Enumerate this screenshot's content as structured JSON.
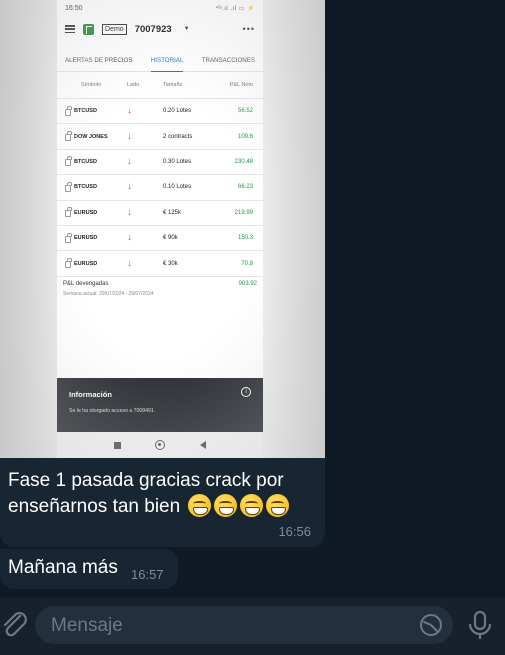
{
  "phone": {
    "status_time": "16:50",
    "status_right": "⁴ᴳ.ıl .ıl ▭ ⚡",
    "account_label": "Demo",
    "account_number": "7007923",
    "tabs": [
      "ALERTAS DE PRECIOS",
      "HISTORIAL",
      "TRANSACCIONES"
    ],
    "columns": [
      "Símbolo",
      "Lado",
      "Tamaño",
      "P&L Neto"
    ],
    "rows": [
      {
        "symbol": "BTCUSD",
        "size": "0.20 Lotes",
        "pnl": "56.52"
      },
      {
        "symbol": "DOW JONES",
        "size": "2 contracts",
        "pnl": "109.6"
      },
      {
        "symbol": "BTCUSD",
        "size": "0.30 Lotes",
        "pnl": "230.48"
      },
      {
        "symbol": "BTCUSD",
        "size": "0.10 Lotes",
        "pnl": "66.23"
      },
      {
        "symbol": "EURUSD",
        "size": "€ 125k",
        "pnl": "219.99"
      },
      {
        "symbol": "EURUSD",
        "size": "€ 90k",
        "pnl": "150.3"
      },
      {
        "symbol": "EURUSD",
        "size": "€ 30k",
        "pnl": "70.8"
      }
    ],
    "pnl_label": "P&L devengadas",
    "pnl_value": "903.92",
    "week_label": "Semana actual: 29/07/2024 - 29/07/2024",
    "info_title": "Información",
    "info_text": "Se le ha otorgado acceso a 7008491."
  },
  "message1": {
    "text": "Fase 1 pasada gracias crack por enseñarnos tan bien",
    "time": "16:56"
  },
  "message2": {
    "text": "Mañana más",
    "time": "16:57"
  },
  "input": {
    "placeholder": "Mensaje"
  }
}
